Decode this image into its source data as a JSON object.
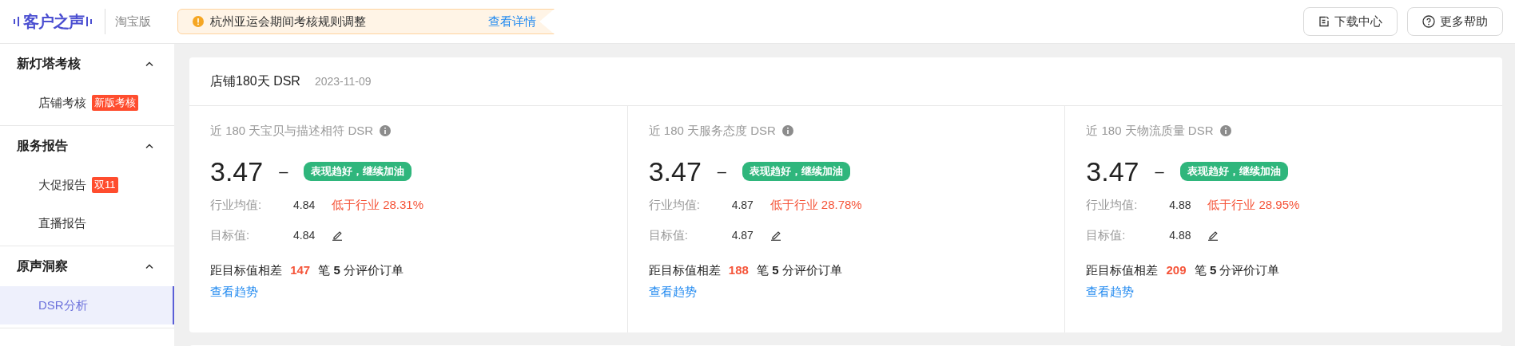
{
  "header": {
    "logo": "客户之声",
    "edition": "淘宝版",
    "notice": {
      "text": "杭州亚运会期间考核规则调整",
      "link": "查看详情"
    },
    "buttons": [
      {
        "label": "下载中心",
        "kind": "download"
      },
      {
        "label": "更多帮助",
        "kind": "help"
      }
    ]
  },
  "sidebar": {
    "groups": [
      {
        "title": "新灯塔考核",
        "expanded": true,
        "items": [
          {
            "label": "店铺考核",
            "badge": "新版考核",
            "selected": false
          }
        ]
      },
      {
        "title": "服务报告",
        "expanded": true,
        "items": [
          {
            "label": "大促报告",
            "badge": "双11",
            "selected": false
          },
          {
            "label": "直播报告",
            "selected": false
          }
        ]
      },
      {
        "title": "原声洞察",
        "expanded": true,
        "items": [
          {
            "label": "DSR分析",
            "selected": true
          }
        ]
      }
    ]
  },
  "dsr_card": {
    "title": "店铺180天 DSR",
    "date": "2023-11-09",
    "metrics": [
      {
        "title": "近 180 天宝贝与描述相符 DSR",
        "score": "3.47",
        "trend": "–",
        "tag": "表现趋好，继续加油",
        "industry_label": "行业均值:",
        "industry_value": "4.84",
        "compare": "低于行业 28.31%",
        "target_label": "目标值:",
        "target_value": "4.84",
        "gap": "距目标值相差 **147** 笔 **5** 分评价订单",
        "link": "查看趋势"
      },
      {
        "title": "近 180 天服务态度 DSR",
        "score": "3.47",
        "trend": "–",
        "tag": "表现趋好，继续加油",
        "industry_label": "行业均值:",
        "industry_value": "4.87",
        "compare": "低于行业 28.78%",
        "target_label": "目标值:",
        "target_value": "4.87",
        "gap": "距目标值相差 **188** 笔 **5** 分评价订单",
        "link": "查看趋势"
      },
      {
        "title": "近 180 天物流质量 DSR",
        "score": "3.47",
        "trend": "–",
        "tag": "表现趋好，继续加油",
        "industry_label": "行业均值:",
        "industry_value": "4.88",
        "compare": "低于行业 28.95%",
        "target_label": "目标值:",
        "target_value": "4.88",
        "gap": "距目标值相差 **209** 笔 **5** 分评价订单",
        "link": "查看趋势"
      }
    ]
  }
}
